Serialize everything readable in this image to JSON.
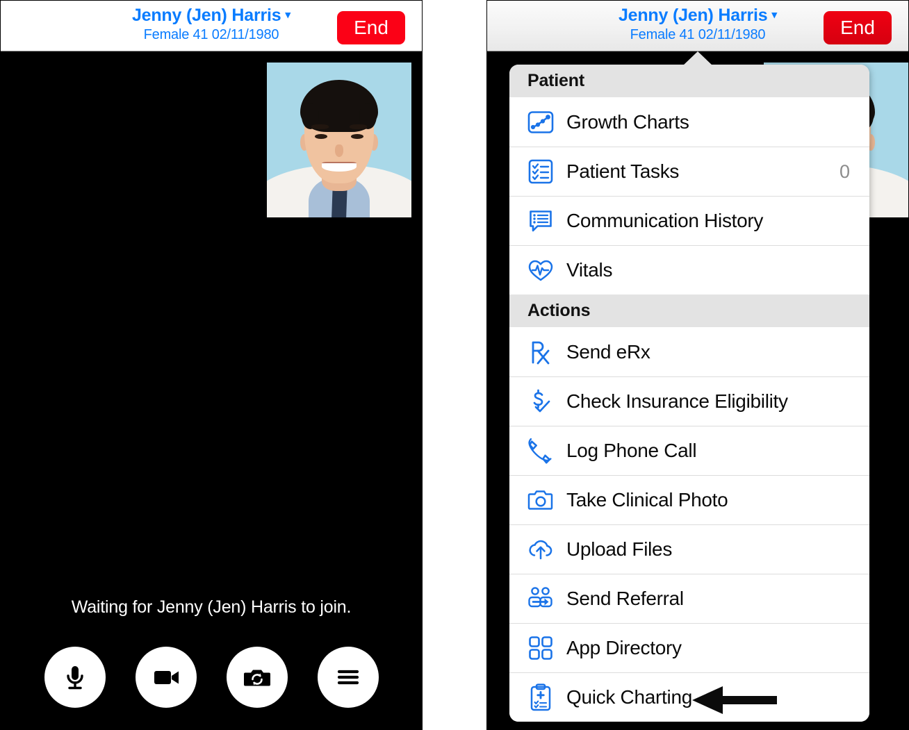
{
  "header": {
    "patient_name": "Jenny (Jen) Harris",
    "chevron_icon": "chevron-down-icon",
    "patient_details": "Female 41 02/11/1980",
    "end_label": "End",
    "end_color": "#fb0116",
    "link_color": "#0a7cff"
  },
  "video": {
    "waiting_text": "Waiting for Jenny (Jen) Harris to join.",
    "selfview_alt": "provider-self-view-photo",
    "controls": [
      {
        "name": "microphone-button",
        "icon": "microphone-icon"
      },
      {
        "name": "camera-button",
        "icon": "video-camera-icon"
      },
      {
        "name": "flip-camera-button",
        "icon": "camera-flip-icon"
      },
      {
        "name": "more-menu-button",
        "icon": "hamburger-menu-icon"
      }
    ]
  },
  "menu": {
    "sections": [
      {
        "title": "Patient",
        "items": [
          {
            "label": "Growth Charts",
            "icon": "growth-chart-icon",
            "count": ""
          },
          {
            "label": "Patient Tasks",
            "icon": "task-list-icon",
            "count": "0"
          },
          {
            "label": "Communication History",
            "icon": "chat-history-icon",
            "count": ""
          },
          {
            "label": "Vitals",
            "icon": "heart-pulse-icon",
            "count": ""
          }
        ]
      },
      {
        "title": "Actions",
        "items": [
          {
            "label": "Send eRx",
            "icon": "prescription-rx-icon",
            "count": ""
          },
          {
            "label": "Check Insurance Eligibility",
            "icon": "dollar-check-icon",
            "count": ""
          },
          {
            "label": "Log Phone Call",
            "icon": "phone-icon",
            "count": ""
          },
          {
            "label": "Take Clinical Photo",
            "icon": "camera-icon",
            "count": ""
          },
          {
            "label": "Upload Files",
            "icon": "cloud-upload-icon",
            "count": ""
          },
          {
            "label": "Send Referral",
            "icon": "send-referral-icon",
            "count": ""
          },
          {
            "label": "App Directory",
            "icon": "grid-apps-icon",
            "count": ""
          },
          {
            "label": "Quick Charting",
            "icon": "clipboard-plus-icon",
            "count": ""
          }
        ]
      }
    ],
    "accent_color": "#1a73e8",
    "section_bg": "#e3e3e3"
  },
  "annotation": {
    "target": "Quick Charting",
    "icon": "left-pointing-arrow"
  }
}
